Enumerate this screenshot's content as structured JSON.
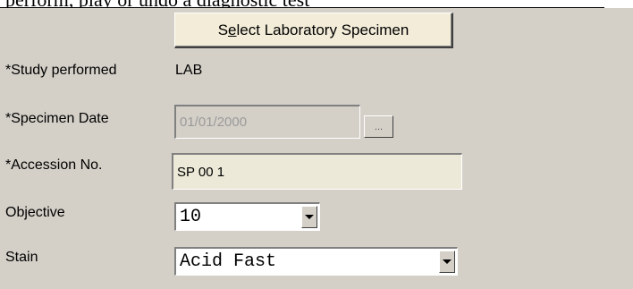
{
  "header": {
    "clipped_text": "perform, play or undo a diagnostic test"
  },
  "select_button": {
    "label": "Select Laboratory Specimen",
    "mnemonic": "e"
  },
  "form": {
    "study_performed": {
      "label": "*Study performed",
      "value": "LAB"
    },
    "specimen_date": {
      "label": "*Specimen Date",
      "value": "01/01/2000",
      "button_label": "..."
    },
    "accession_no": {
      "label": "*Accession No.",
      "value": "SP 00 1"
    },
    "objective": {
      "label": "Objective",
      "value": "10"
    },
    "stain": {
      "label": "Stain",
      "value": "Acid Fast"
    }
  },
  "icons": {
    "dropdown": "chevron-down-icon"
  }
}
